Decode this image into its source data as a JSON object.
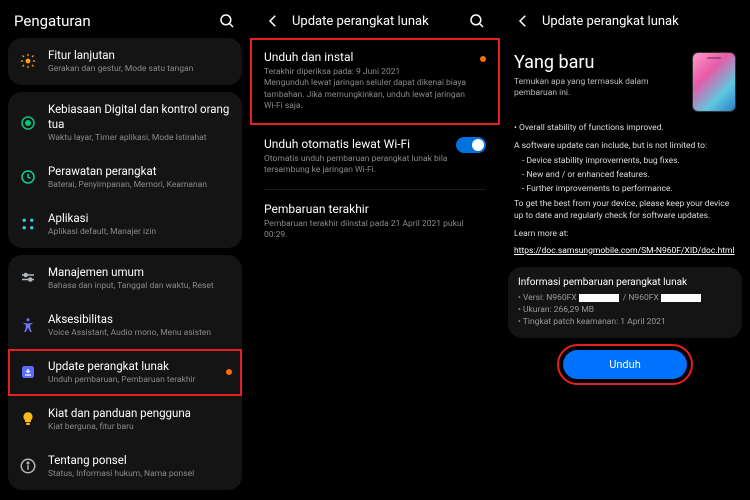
{
  "p1": {
    "title": "Pengaturan",
    "items": [
      {
        "t": "Fitur lanjutan",
        "s": "Gerakan dan gestur, Mode satu tangan"
      },
      {
        "t": "Kebiasaan Digital dan kontrol orang tua",
        "s": "Waktu layar, Timer aplikasi, Mode Istirahat"
      },
      {
        "t": "Perawatan perangkat",
        "s": "Baterai, Penyimpanan, Memori, Keamanan"
      },
      {
        "t": "Aplikasi",
        "s": "Aplikasi default, Manajer izin"
      },
      {
        "t": "Manajemen umum",
        "s": "Bahasa dan input, Tanggal dan waktu, Reset"
      },
      {
        "t": "Aksesibilitas",
        "s": "Voice Assistant, Audio mono, Menu asisten"
      },
      {
        "t": "Update perangkat lunak",
        "s": "Unduh pembaruan, Pembaruan terakhir"
      },
      {
        "t": "Kiat dan panduan pengguna",
        "s": "Kiat berguna, fitur baru"
      },
      {
        "t": "Tentang ponsel",
        "s": "Status, Informasi hukum, Nama ponsel"
      }
    ]
  },
  "p2": {
    "title": "Update perangkat lunak",
    "items": [
      {
        "t": "Unduh dan instal",
        "s": "Terakhir diperiksa pada: 9 Juni 2021\nMengunduh lewat jaringan seluler dapat dikenai biaya tambahan. Jika memungkinkan, unduh lewat jaringan Wi-Fi saja."
      },
      {
        "t": "Unduh otomatis lewat Wi-Fi",
        "s": "Otomatis unduh pembaruan perangkat lunak bila tersambung ke jaringan Wi-Fi."
      },
      {
        "t": "Pembaruan terakhir",
        "s": "Pembaruan terakhir diinstal pada 21 April 2021 pukul 00:29."
      }
    ]
  },
  "p3": {
    "title": "Update perangkat lunak",
    "hero_t": "Yang baru",
    "hero_s": "Temukan apa yang termasuk dalam pembaruan ini.",
    "body": {
      "l1": "• Overall stability of functions improved.",
      "l2": "A software update can include, but is not limited to:",
      "l3": "- Device stability improvements, bug fixes.",
      "l4": "- New and / or enhanced features.",
      "l5": "- Further improvements to performance.",
      "l6": "To get the best from your device, please keep your device up to date and regularly check for software updates.",
      "l7": "Learn more at:",
      "link": "https://doc.samsungmobile.com/SM-N960F/XID/doc.html"
    },
    "info": {
      "t": "Informasi pembaruan perangkat lunak",
      "v1a": "• Versi: N960FX",
      "v1b": " / N960FX",
      "v2": "• Ukuran: 266,29 MB",
      "v3": "• Tingkat patch keamanan: 1 April 2021"
    },
    "btn": "Unduh"
  }
}
